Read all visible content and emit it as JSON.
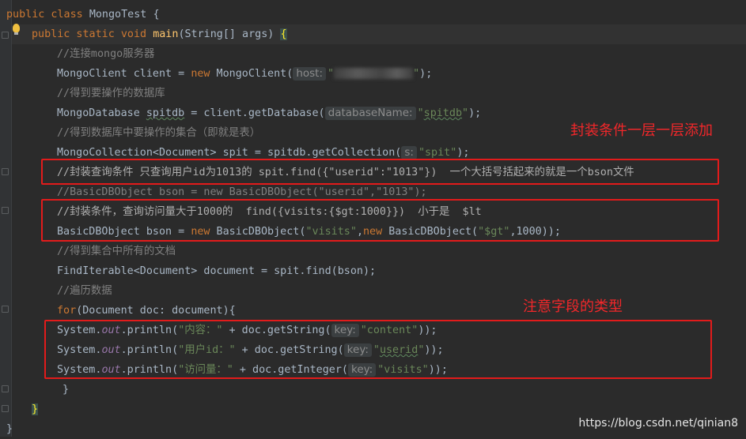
{
  "colors": {
    "background": "#2b2b2b",
    "keyword": "#cc7832",
    "string": "#6a8759",
    "comment": "#808080",
    "method_decl": "#ffc66d",
    "field": "#9876aa",
    "annotation_red": "#e21b1b"
  },
  "code": {
    "class_decl": {
      "kw": "public class",
      "name": "MongoTest",
      "brace": "{"
    },
    "main_decl": {
      "kw": "public static void",
      "method": "main",
      "params": "(String[] args)",
      "brace": "{"
    },
    "c1": "//连接mongo服务器",
    "l_client": {
      "type": "MongoClient client = ",
      "kw": "new",
      "ctor": " MongoClient(",
      "hint": "host:",
      "s_open": "\"",
      "s_close": "\"",
      "end": ");"
    },
    "c2": "//得到要操作的数据库",
    "l_db": {
      "pre": "MongoDatabase ",
      "var": "spitdb",
      "mid": " = client.getDatabase(",
      "hint": "databaseName:",
      "s_q1": "\"",
      "s_val": "spitdb",
      "s_q2": "\"",
      "end": ");"
    },
    "c3": "//得到数据库中要操作的集合（即就是表）",
    "l_coll": {
      "pre": "MongoCollection<Document> spit = spitdb.getCollection(",
      "hint": "s:",
      "str": "\"spit\"",
      "end": ");"
    },
    "c4": "//封装查询条件 只查询用户id为1013的 spit.find({\"userid\":\"1013\"})  一个大括号括起来的就是一个bson文件",
    "c5": "//BasicDBObject bson = new BasicDBObject(\"userid\",\"1013\");",
    "c6": "//封装条件，查询访问量大于1000的  find({visits:{$gt:1000}})  小于是  $lt",
    "l_bson": {
      "pre": "BasicDBObject bson = ",
      "kw1": "new",
      "mid1": " BasicDBObject(",
      "s1": "\"visits\"",
      "comma": ",",
      "kw2": "new",
      "mid2": " BasicDBObject(",
      "s2": "\"$gt\"",
      "end": ",1000));"
    },
    "c7": "//得到集合中所有的文档",
    "l_find": "FindIterable<Document> document = spit.find(bson);",
    "c8": "//遍历数据",
    "l_for": {
      "kw": "for",
      "rest": "(Document doc: document){"
    },
    "p1": {
      "pre": "System.",
      "out": "out",
      "mid": ".println(",
      "s": "\"内容：\"",
      "mid2": " + doc.getString(",
      "hint": "key:",
      "s2": "\"content\"",
      "end": "));"
    },
    "p2": {
      "pre": "System.",
      "out": "out",
      "mid": ".println(",
      "s": "\"用户id：\"",
      "mid2": " + doc.getString(",
      "hint": "key:",
      "s2_q1": "\"",
      "s2_val": "userid",
      "s2_q2": "\"",
      "end": "));"
    },
    "p3": {
      "pre": "System.",
      "out": "out",
      "mid": ".println(",
      "s": "\"访问量：\"",
      "mid2": " + doc.getInteger(",
      "hint": "key:",
      "s2": "\"visits\"",
      "end": "));"
    },
    "close_for": "}",
    "close_main": "}",
    "close_class": "}"
  },
  "annotations": {
    "note1": "封装条件一层一层添加",
    "note2": "注意字段的类型"
  },
  "watermark": "https://blog.csdn.net/qinian8"
}
